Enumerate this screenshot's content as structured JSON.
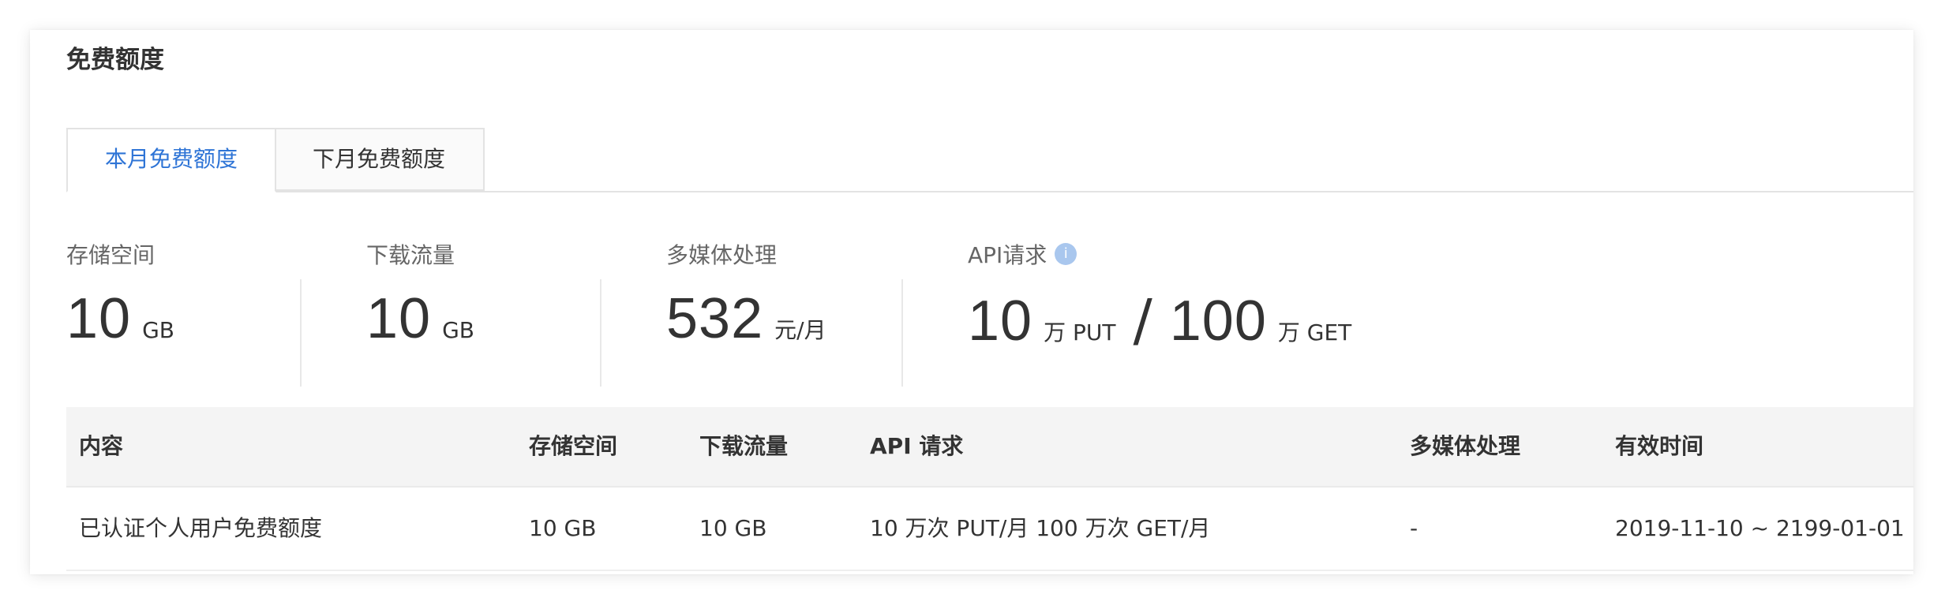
{
  "section": {
    "title": "免费额度"
  },
  "tabs": [
    {
      "label": "本月免费额度",
      "active": true
    },
    {
      "label": "下月免费额度",
      "active": false
    }
  ],
  "stats": {
    "storage": {
      "label": "存储空间",
      "value": "10",
      "unit": "GB"
    },
    "download": {
      "label": "下载流量",
      "value": "10",
      "unit": "GB"
    },
    "media": {
      "label": "多媒体处理",
      "value": "532",
      "unit": "元/月"
    },
    "api": {
      "label": "API请求",
      "info_icon": "i",
      "put_value": "10",
      "put_unit": "万 PUT",
      "separator": "/",
      "get_value": "100",
      "get_unit": "万 GET"
    }
  },
  "table": {
    "headers": [
      "内容",
      "存储空间",
      "下载流量",
      "API 请求",
      "多媒体处理",
      "有效时间"
    ],
    "rows": [
      [
        "已认证个人用户免费额度",
        "10 GB",
        "10 GB",
        "10 万次 PUT/月 100 万次 GET/月",
        "-",
        "2019-11-10 ~ 2199-01-01"
      ]
    ]
  },
  "colors": {
    "accent": "#2e74d6",
    "info_icon_bg": "#a9c7ee",
    "header_bg": "#f4f4f4"
  },
  "icons": {
    "api_info": "info-circle-icon"
  }
}
